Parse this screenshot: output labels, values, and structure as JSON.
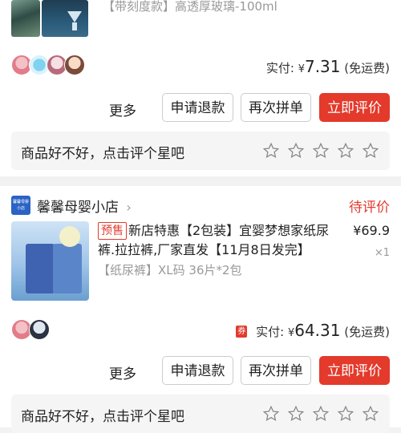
{
  "order1": {
    "spec": "【带刻度款】高透厚玻璃-100ml",
    "paid_label": "实付:",
    "currency": "¥",
    "amount": "7.31",
    "shipping": "(免运费)",
    "actions": {
      "more": "更多",
      "refund": "申请退款",
      "rebuy": "再次拼单",
      "review": "立即评价"
    },
    "rating_prompt": "商品好不好，点击评个星吧"
  },
  "order2": {
    "shop_logo_text": "馨馨母婴小店",
    "shop_name": "馨馨母婴小店",
    "status": "待评价",
    "tag": "预售",
    "title": "新店特惠【2包装】宜婴梦想家纸尿裤.拉拉裤,厂家直发【11月8日发完】",
    "price": "¥69.9",
    "qty": "×1",
    "spec": "【纸尿裤】XL码 36片*2包",
    "coupon": "券",
    "paid_label": "实付:",
    "currency": "¥",
    "amount": "64.31",
    "shipping": "(免运费)",
    "actions": {
      "more": "更多",
      "refund": "申请退款",
      "rebuy": "再次拼单",
      "review": "立即评价"
    },
    "rating_prompt": "商品好不好，点击评个星吧"
  },
  "colors": {
    "accent": "#e33a2c",
    "status": "#e23b2e",
    "muted": "#999999"
  }
}
